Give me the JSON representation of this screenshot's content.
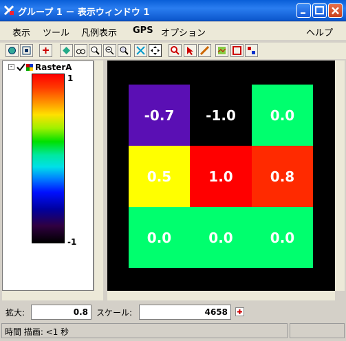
{
  "window": {
    "title": "グループ 1 － 表示ウィンドウ 1"
  },
  "menu": [
    "表示",
    "ツール",
    "凡例表示",
    "GPS",
    "オプション",
    "ヘルプ"
  ],
  "toolbar": {
    "tools": [
      "refresh-icon",
      "frame-icon",
      "add-layer-icon",
      "layer-icon",
      "binoculars-icon",
      "zoom-in-icon",
      "zoom-out-icon",
      "zoom-box-icon",
      "pan-icon",
      "full-extent-icon",
      "zoom-red-icon",
      "pointer-icon",
      "measure-icon",
      "map-icon",
      "select-box-icon",
      "grid-icon"
    ]
  },
  "legend": {
    "layer_name": "RasterA",
    "max_label": "1",
    "min_label": "-1",
    "colors": {
      "top": "#ff0000",
      "mid": "#00e000",
      "bottom": "#000000"
    }
  },
  "raster": {
    "rows": [
      [
        {
          "value": "-0.7",
          "color": "#5a0fb4"
        },
        {
          "value": "-1.0",
          "color": "#000000"
        },
        {
          "value": "0.0",
          "color": "#00ff6e"
        }
      ],
      [
        {
          "value": "0.5",
          "color": "#ffff00"
        },
        {
          "value": "1.0",
          "color": "#ff0000"
        },
        {
          "value": "0.8",
          "color": "#ff2a00"
        }
      ],
      [
        {
          "value": "0.0",
          "color": "#00ff6e"
        },
        {
          "value": "0.0",
          "color": "#00ff6e"
        },
        {
          "value": "0.0",
          "color": "#00ff6e"
        }
      ]
    ]
  },
  "zoom": {
    "label": "拡大:",
    "value": "0.8"
  },
  "scale": {
    "label": "スケール:",
    "value": "4658"
  },
  "status": {
    "text": "時間 描画: <1 秒"
  }
}
